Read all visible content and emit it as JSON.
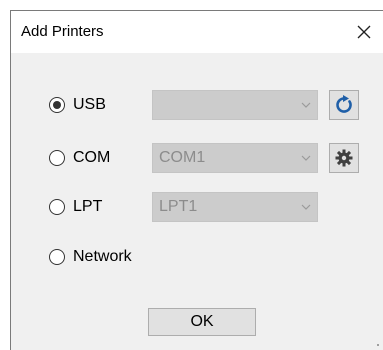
{
  "window": {
    "title": "Add Printers",
    "close_glyph": "✕"
  },
  "connections": {
    "usb": {
      "label": "USB",
      "selected": true,
      "combo_value": ""
    },
    "com": {
      "label": "COM",
      "selected": false,
      "combo_value": "COM1"
    },
    "lpt": {
      "label": "LPT",
      "selected": false,
      "combo_value": "LPT1"
    },
    "network": {
      "label": "Network",
      "selected": false
    }
  },
  "icons": {
    "refresh": "refresh-icon",
    "settings": "gear-icon",
    "dropdown": "chevron-down-icon"
  },
  "colors": {
    "refresh_icon": "#1f5fa8",
    "gear_icon": "#404040"
  },
  "footer": {
    "ok_label": "OK"
  }
}
